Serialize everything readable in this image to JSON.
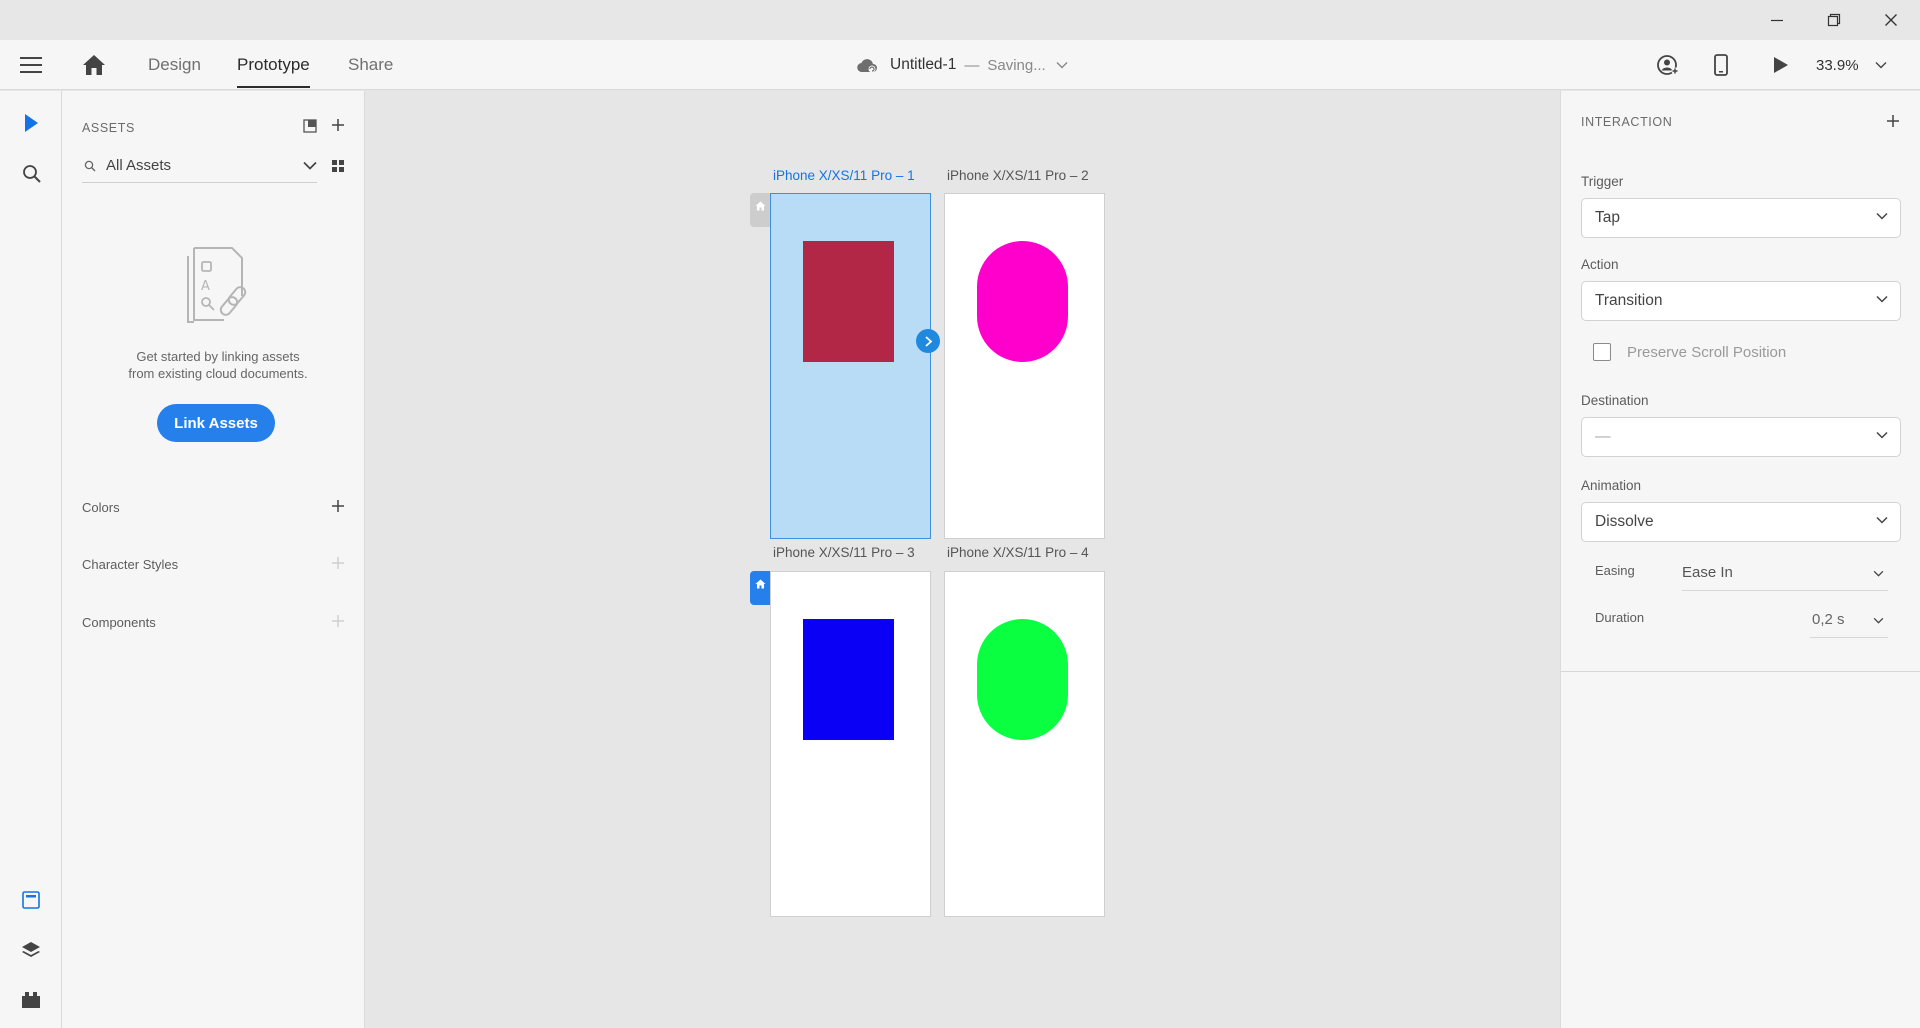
{
  "colors": {
    "accent": "#1473e6",
    "link_button": "#2680eb",
    "shape_rect_1": "#b22745",
    "shape_pill_2": "#ff00cc",
    "shape_rect_3": "#0a00f6",
    "shape_pill_4": "#0aff40",
    "selected_artboard": "#b9dcf6"
  },
  "appbar": {
    "tabs": [
      "Design",
      "Prototype",
      "Share"
    ],
    "active_tab": "Prototype",
    "doc_title": "Untitled-1",
    "separator": "—",
    "status": "Saving...",
    "zoom": "33.9%"
  },
  "assets": {
    "header": "ASSETS",
    "filter_value": "All Assets",
    "empty_line1": "Get started by linking assets",
    "empty_line2": "from existing cloud documents.",
    "link_button": "Link Assets",
    "sections": [
      "Colors",
      "Character Styles",
      "Components"
    ]
  },
  "canvas": {
    "artboards": [
      {
        "title": "iPhone X/XS/11 Pro – 1",
        "selected": true,
        "home": true,
        "shape": "rect"
      },
      {
        "title": "iPhone X/XS/11 Pro – 2",
        "selected": false,
        "home": false,
        "shape": "pill"
      },
      {
        "title": "iPhone X/XS/11 Pro – 3",
        "selected": false,
        "home": true,
        "shape": "rect"
      },
      {
        "title": "iPhone X/XS/11 Pro – 4",
        "selected": false,
        "home": false,
        "shape": "pill"
      }
    ]
  },
  "inspector": {
    "header": "INTERACTION",
    "trigger_label": "Trigger",
    "trigger_value": "Tap",
    "action_label": "Action",
    "action_value": "Transition",
    "preserve_scroll": "Preserve Scroll Position",
    "destination_label": "Destination",
    "destination_value": "—",
    "animation_label": "Animation",
    "animation_value": "Dissolve",
    "easing_label": "Easing",
    "easing_value": "Ease In",
    "duration_label": "Duration",
    "duration_value": "0,2 s"
  },
  "icons": {
    "rail_top": [
      "select-icon",
      "search-icon"
    ],
    "rail_bottom": [
      "artboard-icon",
      "layers-icon",
      "plugins-icon"
    ]
  }
}
